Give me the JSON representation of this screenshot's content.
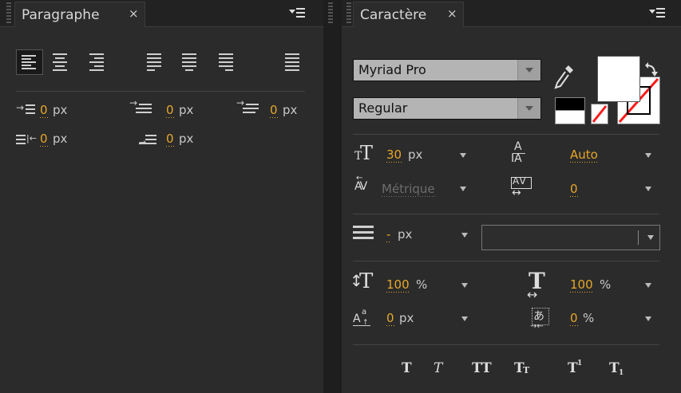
{
  "paragraph_panel": {
    "title": "Paragraphe",
    "close_glyph": "×",
    "indent_left": {
      "value": "0",
      "unit": "px"
    },
    "indent_first": {
      "value": "0",
      "unit": "px"
    },
    "indent_right": {
      "value": "0",
      "unit": "px"
    },
    "space_before": {
      "value": "0",
      "unit": "px"
    },
    "space_after": {
      "value": "0",
      "unit": "px"
    }
  },
  "character_panel": {
    "title": "Caractère",
    "close_glyph": "×",
    "font_family": "Myriad Pro",
    "font_style": "Regular",
    "font_size": {
      "value": "30",
      "unit": "px"
    },
    "leading": {
      "value": "Auto"
    },
    "kerning": {
      "value": "Métrique"
    },
    "tracking": {
      "value": "0"
    },
    "stroke_width": {
      "value": "-",
      "unit": "px"
    },
    "vertical_scale": {
      "value": "100",
      "unit": "%"
    },
    "horizontal_scale": {
      "value": "100",
      "unit": "%"
    },
    "baseline_shift": {
      "value": "0",
      "unit": "px"
    },
    "tsume": {
      "value": "0",
      "unit": "%"
    },
    "format_buttons": {
      "bold": "T",
      "italic": "T",
      "all_caps": "TT",
      "small_caps_big": "T",
      "small_caps_small": "T",
      "superscript_base": "T",
      "superscript_mark": "1",
      "subscript_base": "T",
      "subscript_mark": "1"
    },
    "colors": {
      "fill": "#ffffff",
      "stroke_none": "#ff1a1a",
      "accent_value": "#e6a72a"
    }
  },
  "icons": [
    "panel-menu-icon",
    "eyedropper-icon",
    "swap-colors-icon",
    "align-left-icon",
    "align-center-icon",
    "align-right-icon",
    "justify-last-left-icon",
    "justify-last-center-icon",
    "justify-last-right-icon",
    "justify-all-icon",
    "font-size-icon",
    "leading-icon",
    "kerning-icon",
    "tracking-icon",
    "stroke-width-icon",
    "vertical-scale-icon",
    "horizontal-scale-icon",
    "baseline-shift-icon",
    "tsume-icon"
  ]
}
